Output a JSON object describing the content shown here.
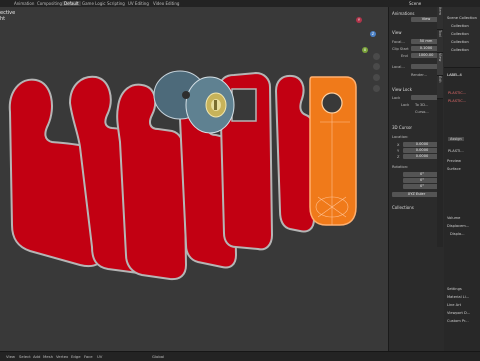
{
  "topbar": {
    "tabs": [
      {
        "label": "Animation"
      },
      {
        "label": "Compositing"
      },
      {
        "label": "Default",
        "active": true
      },
      {
        "label": "Game Logic"
      },
      {
        "label": "Scripting"
      },
      {
        "label": "UV Editing"
      },
      {
        "label": "Video Editing"
      }
    ],
    "scene_label": "Scene"
  },
  "viewport": {
    "overlay_lines": [
      "ective",
      "ht"
    ]
  },
  "npanel": {
    "animations": "Animations",
    "animations_value": "View",
    "view": "View",
    "focal_label": "Focal...",
    "focal_value": "50 mm",
    "clip_start_label": "Clip Start",
    "clip_start_value": "0.1000",
    "clip_end_label": "End",
    "clip_end_value": "1000.00",
    "local_label": "Local...",
    "render_label": "Render...",
    "view_lock": "View Lock",
    "lock_label": "Lock",
    "lock_to_3d": "To 3D...",
    "cursor_label": "Curso...",
    "cursor3d": "3D Cursor",
    "location_label": "Location:",
    "loc_x": "X",
    "loc_x_value": "0.0000",
    "loc_y": "Y",
    "loc_y_value": "0.0000",
    "loc_z": "Z",
    "loc_z_value": "0.0000",
    "rotation_label": "Rotation:",
    "rot_x_value": "0°",
    "rot_y_value": "0°",
    "rot_z_value": "0°",
    "rot_mode": "XYZ Euler",
    "collections": "Collections"
  },
  "vtabs": [
    "Item",
    "Tool",
    "View",
    "Edit"
  ],
  "outliner": {
    "rows": [
      "Scene Collection",
      "Collection",
      "Collection",
      "Collection",
      "Collection"
    ]
  },
  "properties": {
    "label_name": "LABEL-4",
    "material_1": "PLASTIC...",
    "material_2": "PLASTIC...",
    "rows": [
      "Preview",
      "Surface",
      "Volume",
      "Displacem...",
      "Displa...",
      "Settings",
      "Material Li...",
      "Line Art",
      "Viewport D...",
      "Custom Pr..."
    ],
    "assign_label": "Assign",
    "surface_value": "PLASTI..."
  },
  "statusbar": {
    "items": [
      "View",
      "Select",
      "Add",
      "Mesh",
      "Vertex",
      "Edge",
      "Face",
      "UV"
    ],
    "global": "Global"
  },
  "colors": {
    "hanger_red": "#c20012",
    "hanger_outline": "#b5b5b5",
    "orange": "#f07a1a",
    "background": "#393939"
  }
}
